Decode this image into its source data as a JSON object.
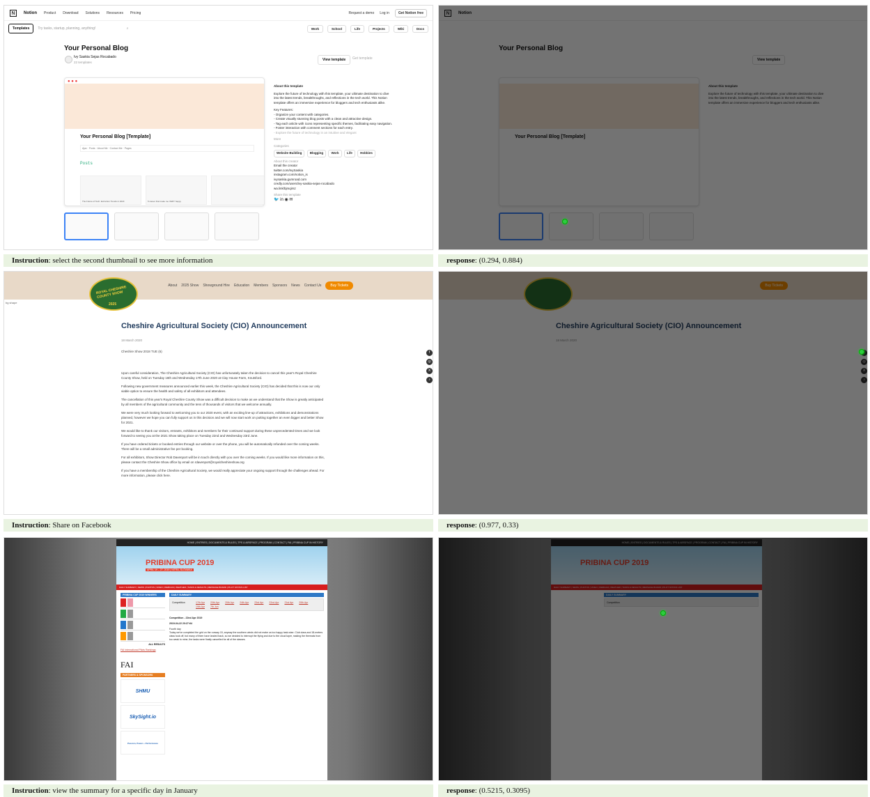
{
  "rows": [
    {
      "instruction_label": "Instruction",
      "instruction": "select the second thumbnail to see more information",
      "response_label": "response",
      "response": "(0.294, 0.884)"
    },
    {
      "instruction_label": "Instruction",
      "instruction": "Share on Facebook",
      "response_label": "response",
      "response": "(0.977, 0.33)"
    },
    {
      "instruction_label": "Instruction",
      "instruction": "view the summary for a specific day in January",
      "response_label": "response",
      "response": "(0.5215, 0.3095)"
    }
  ],
  "notion": {
    "nav": {
      "brand": "Notion",
      "items": [
        "Product",
        "Download",
        "Solutions",
        "Resources",
        "Pricing"
      ],
      "request": "Request a demo",
      "login": "Log in",
      "cta": "Get Notion free"
    },
    "search": {
      "templates_btn": "Templates",
      "placeholder": "Try tasks, startup, planning, anything!",
      "cats": [
        "Work",
        "School",
        "Life",
        "Projects",
        "Wiki",
        "Docs"
      ]
    },
    "title": "Your Personal Blog",
    "author": "Ivy Saskia Sejas Rocabado",
    "count": "22 templates",
    "view_btn": "View template",
    "get_btn": "Get template",
    "preview": {
      "title": "Your Personal Blog [Template]",
      "crumb": "Ajax · Posts · About Me · Contact Me · Pages",
      "posts": "Posts",
      "cards": [
        "The Future of Tech: Extinction Trends in 2023",
        "5 career that make me VERY happy",
        ""
      ]
    },
    "about": {
      "heading": "About this template",
      "text": "Explore the future of technology with this template, your ultimate destination to dive into the latest trends, breakthroughs, and reflections in the tech world. This Notion template offers an immersive experience for bloggers and tech enthusiasts alike.",
      "features_title": "Key Features:",
      "features": [
        "- Organize your content with categories.",
        "- Create visually stunning blog posts with a clean and attractive design.",
        "- Tag each article with icons representing specific themes, facilitating easy navigation.",
        "- Foster interaction with comment sections for each entry.",
        "- Explore the future of technology in an intuitive and elegant"
      ],
      "more": "More",
      "categories_label": "Categories",
      "tags": [
        "Website Building",
        "Blogging",
        "Work",
        "Life",
        "Hobbies"
      ],
      "creator_label": "About this creator",
      "links": [
        "Email the creator",
        "twitter.com/IvySaskia",
        "instagram.com/notion_is",
        "ivysaskia.gumroad.com",
        "credly.com/users/ivy-saskia-sejas-rocabado",
        "wa.link/bjmqirsz"
      ],
      "share_label": "Share this template"
    }
  },
  "cheshire": {
    "nav": [
      "About",
      "2025 Show",
      "Showground Hire",
      "Education",
      "Members",
      "Sponsors",
      "News",
      "Contact Us"
    ],
    "buy": "Buy Tickets",
    "logo": "ROYAL CHESHIRE COUNTY SHOW",
    "logo_year": "2025",
    "bg_alt": "bg shape",
    "title": "Cheshire Agricultural Society (CIO) Announcement",
    "date": "18 March 2020",
    "img_alt": "Cheshire Show 2018 TUE (6)",
    "paragraphs": [
      "Upon careful consideration, The Cheshire Agricultural Society (CIO) has unfortunately taken the decision to cancel this year's Royal Cheshire County Show, held on Tuesday 16th and Wednesday 17th June 2020 at Clay House Farm, Knutsford.",
      "Following new government measures announced earlier this week, the Cheshire Agricultural Society (CIO) has decided that this is now our only viable option to ensure the health and safety of all exhibitors and attendees.",
      "The cancellation of this year's Royal Cheshire County Show was a difficult decision to make as we understand that the Show is greatly anticipated by all members of the agricultural community and the tens of thousands of visitors that we welcome annually.",
      "We were very much looking forward to welcoming you to our 2020 event, with an exciting line-up of attractions, exhibitions and demonstrations planned, however we hope you can fully support us in this decision and we will now start work on putting together an even bigger and better Show for 2021.",
      "We would like to thank our visitors, entrants, exhibitors and members for their continued support during these unprecedented times and we look forward to seeing you at the 2021 Show taking place on Tuesday 22nd and Wednesday 23rd June.",
      "If you have ordered tickets or booked entries through our website or over the phone, you will be automatically refunded over the coming weeks. There will be a small administrative fee per booking.",
      "For all exhibitors, Show Director Rob Davenport will be in touch directly with you over the coming weeks. If you would like more information on this, please contact the Cheshire Show office by email on rdavenport@royalcheshireshow.org",
      "If you have a membership of the Cheshire Agricultural Society, we would really appreciate your ongoing support through the challenges ahead. For more information, please click here."
    ]
  },
  "pribina": {
    "top": "HOME | ENTRIES | DOCUMENTS & RULES | TPS & AIRSPACE | PROGRAM | CONTACT | FAI | PRIBINA CUP IN HISTORY",
    "logo": "PRIBINA CUP 2019",
    "sub": "APRIL 19 – 27, 2019 | NITRA, SLOVAKIA",
    "menu": "DAILY SUMMARY | NEWS | PHOTOS | VIDEO | WEBCAM | WEATHER | TASKS & RESULTS | MESSAGE BOARD | PILOT STATUS LIST",
    "winners": "PRIBINA CUP 2019 WINNERS",
    "all_results": "ALL RESULTS",
    "fai_label": "FAI International Pilots Rankings",
    "fai": "FAI",
    "partners": "PARTNERS & SPONSORS",
    "sponsors": [
      "SHMU",
      "SkySight.io",
      "Passion, Power + Performance"
    ],
    "summary_hdr": "DAILY SUMMARY",
    "competition": "Competition",
    "dates": [
      "17th Apr",
      "20th Apr",
      "20th Apr",
      "24th Apr",
      "23rd Apr",
      "22nd Apr",
      "21st Apr",
      "20th Apr",
      "19th Apr",
      "7th Jun"
    ],
    "entry_title": "Competition - 22nd Apr 2019",
    "entry_stamp": "2019-04-22 20:27:64",
    "entry_day": "Fourth day",
    "entry_text": "Today we've completed the grid on the runway 15, anyway the southern winds did not make us too happy task-wise. Club class and 18-meters class took off, but many of them have landed back, so we decided to interrupt the flying and due to the cloud layer, making the thermals from too weak to mine, the tasks were finally cancelled for all of the classes."
  }
}
